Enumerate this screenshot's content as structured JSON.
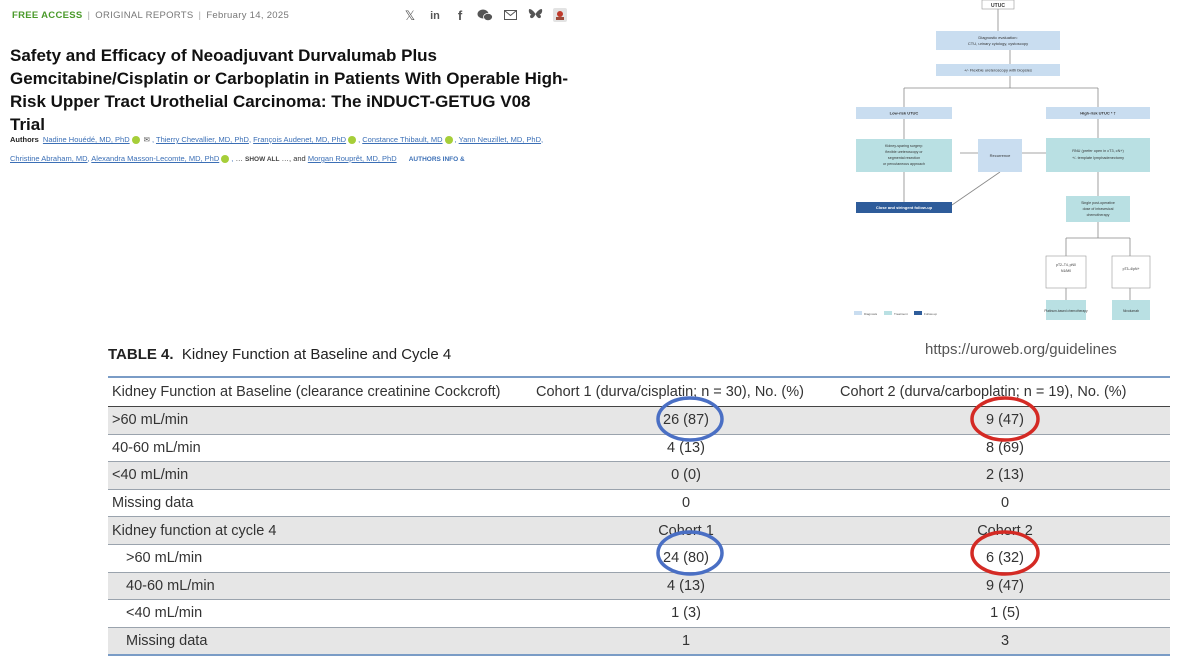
{
  "meta": {
    "free": "FREE ACCESS",
    "type": "ORIGINAL REPORTS",
    "date": "February 14, 2025"
  },
  "share_icons": [
    "x-icon",
    "linkedin-icon",
    "facebook-icon",
    "wechat-icon",
    "email-icon",
    "bluesky-icon",
    "mendeley-icon"
  ],
  "article": {
    "title": "Safety and Efficacy of Neoadjuvant Durvalumab Plus Gemcitabine/Cisplatin or Carboplatin in Patients With Operable High-Risk Upper Tract Urothelial Carcinoma: The iNDUCT-GETUG V08 Trial",
    "authors_label": "Authors",
    "authors": [
      "Nadine Houédé, MD, PhD",
      "Thierry Chevallier, MD, PhD",
      "François Audenet, MD, PhD",
      "Constance Thibault, MD",
      "Yann Neuzillet, MD, PhD",
      "Christine Abraham, MD",
      "Alexandra Masson-Lecomte, MD, PhD",
      "Morgan Rouprêt, MD, PhD"
    ],
    "show_all": "SHOW ALL",
    "ellipsis_before": "…",
    "ellipsis_after": "…, and",
    "authors_info": "AUTHORS INFO &"
  },
  "flowchart": {
    "top": "UTUC",
    "eval": "Diagnostic evaluation:",
    "eval2": "CTU, urinary cytology, cystoscopy",
    "ureteroscopy": "+/- Flexible ureteroscopy with biopsies",
    "low_risk": "Low-risk UTUC",
    "high_risk": "High-risk UTUC * †",
    "kidney_sparing1": "Kidney-sparing surgery:",
    "kidney_sparing2": "flexible ureteroscopy or",
    "kidney_sparing3": "segmental resection",
    "kidney_sparing4": "or percutaneous approach",
    "recurrence": "Recurrence",
    "rnu1": "RNU (prefer open in cT3, cN+)",
    "rnu2": "+/- template lymphadenectomy",
    "followup": "Close and stringent follow-up",
    "single1": "Single post-operative",
    "single2": "dose of intravesical",
    "single3": "chemotherapy",
    "pt_left1": "pT2–T4, pN0",
    "pt_left2": "N1/M0",
    "pt_right1": "pT3–4/pN+",
    "platinum": "Platinum-based chemotherapy",
    "nivolumab": "Nivolumab",
    "legend": [
      "Diagnosis",
      "Treatment",
      "Follow-up"
    ],
    "colors": {
      "light": "#c9ddf0",
      "teal": "#b9e0e3",
      "dark": "#2e5c9a"
    }
  },
  "table": {
    "caption_label": "TABLE 4.",
    "caption_text": "Kidney Function at Baseline and Cycle 4",
    "url": "https://uroweb.org/guidelines",
    "headers": [
      "Kidney Function at Baseline (clearance creatinine Cockcroft)",
      "Cohort 1 (durva/cisplatin; n = 30), No. (%)",
      "Cohort 2 (durva/carboplatin; n = 19), No. (%)"
    ],
    "rows": [
      [
        ">60 mL/min",
        "26 (87)",
        "9 (47)"
      ],
      [
        "40-60 mL/min",
        "4 (13)",
        "8 (69)"
      ],
      [
        "<40 mL/min",
        "0 (0)",
        "2 (13)"
      ],
      [
        "Missing data",
        "0",
        "0"
      ],
      [
        "Kidney function at cycle 4",
        "Cohort 1",
        "Cohort 2"
      ],
      [
        ">60 mL/min",
        "24 (80)",
        "6 (32)"
      ],
      [
        "40-60 mL/min",
        "4 (13)",
        "9 (47)"
      ],
      [
        "<40 mL/min",
        "1 (3)",
        "1 (5)"
      ],
      [
        "Missing data",
        "1",
        "3"
      ]
    ]
  },
  "annotation_colors": {
    "blue": "#4a6fc4",
    "red": "#d42a24"
  }
}
